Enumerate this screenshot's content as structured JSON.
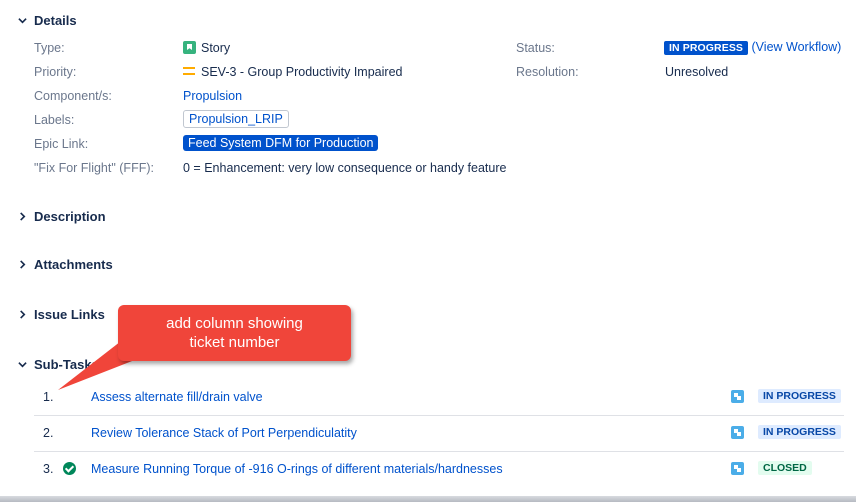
{
  "details": {
    "heading": "Details",
    "type": {
      "label": "Type:",
      "value": "Story"
    },
    "priority": {
      "label": "Priority:",
      "value": "SEV-3 - Group Productivity Impaired"
    },
    "components": {
      "label": "Component/s:",
      "value": "Propulsion"
    },
    "labels": {
      "label": "Labels:",
      "value": "Propulsion_LRIP"
    },
    "epic": {
      "label": "Epic Link:",
      "value": "Feed System DFM for Production"
    },
    "fff": {
      "label": "\"Fix For Flight\" (FFF):",
      "value": "0 = Enhancement: very low consequence or handy feature"
    },
    "status": {
      "label": "Status:",
      "value": "IN PROGRESS",
      "workflow_link": "(View Workflow)"
    },
    "resolution": {
      "label": "Resolution:",
      "value": "Unresolved"
    }
  },
  "sections": {
    "description": "Description",
    "attachments": "Attachments",
    "issue_links": "Issue Links",
    "subtasks": "Sub-Tasks"
  },
  "subtasks": [
    {
      "num": "1.",
      "summary": "Assess alternate fill/drain valve",
      "status": "IN PROGRESS",
      "done": false
    },
    {
      "num": "2.",
      "summary": "Review Tolerance Stack of Port Perpendiculatity",
      "status": "IN PROGRESS",
      "done": false
    },
    {
      "num": "3.",
      "summary": "Measure Running Torque of -916 O-rings of different materials/hardnesses",
      "status": "CLOSED",
      "done": true
    }
  ],
  "callout": {
    "line1": "add column showing",
    "line2": "ticket number"
  },
  "colors": {
    "link": "#0052cc",
    "callout": "#f0453a",
    "in_progress": "#0052cc",
    "closed": "#006644"
  }
}
